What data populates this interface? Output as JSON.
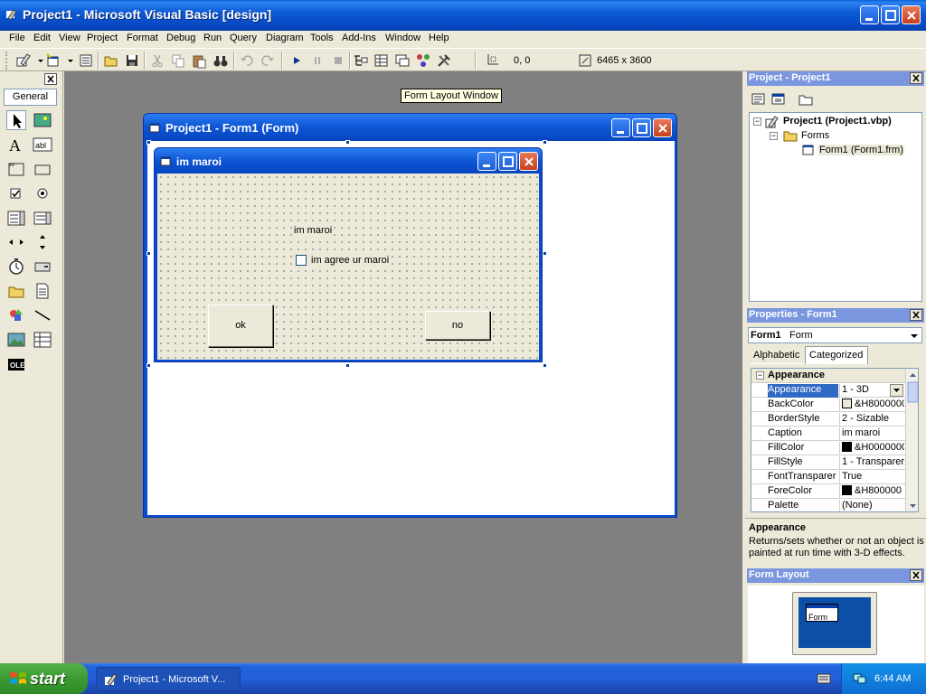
{
  "window": {
    "title": "Project1 - Microsoft Visual Basic [design]"
  },
  "menu": [
    "File",
    "Edit",
    "View",
    "Project",
    "Format",
    "Debug",
    "Run",
    "Query",
    "Diagram",
    "Tools",
    "Add-Ins",
    "Window",
    "Help"
  ],
  "toolbar": {
    "position": "0, 0",
    "size": "6465 x 3600"
  },
  "toolbox": {
    "tab_label": "General"
  },
  "tooltip": "Form Layout Window",
  "designer": {
    "title": "Project1 - Form1 (Form)"
  },
  "form": {
    "caption": "im maroi",
    "label": "im maroi",
    "checkbox_label": "im agree ur maroi",
    "ok_button": "ok",
    "no_button": "no"
  },
  "project_panel": {
    "title": "Project - Project1",
    "root": "Project1 (Project1.vbp)",
    "folder": "Forms",
    "item": "Form1 (Form1.frm)"
  },
  "properties_panel": {
    "title": "Properties - Form1",
    "object_name": "Form1",
    "object_type": "Form",
    "tabs": [
      "Alphabetic",
      "Categorized"
    ],
    "category": "Appearance",
    "rows": [
      {
        "name": "Appearance",
        "value": "1 - 3D"
      },
      {
        "name": "BackColor",
        "value": "&H8000000"
      },
      {
        "name": "BorderStyle",
        "value": "2 - Sizable"
      },
      {
        "name": "Caption",
        "value": "im maroi"
      },
      {
        "name": "FillColor",
        "value": "&H0000000"
      },
      {
        "name": "FillStyle",
        "value": "1 - Transparer"
      },
      {
        "name": "FontTransparer",
        "value": "True"
      },
      {
        "name": "ForeColor",
        "value": "&H800000"
      },
      {
        "name": "Palette",
        "value": "(None)"
      }
    ],
    "desc_title": "Appearance",
    "desc_text": "Returns/sets whether or not an object is painted at run time with 3-D effects."
  },
  "form_layout_panel": {
    "title": "Form Layout",
    "mini_label": "Form"
  },
  "taskbar": {
    "start": "start",
    "task": "Project1 - Microsoft V...",
    "clock": "6:44 AM"
  },
  "colors": {
    "title_blue": "#0d54d4",
    "mdi_gray": "#808080",
    "face": "#ece9d8"
  }
}
